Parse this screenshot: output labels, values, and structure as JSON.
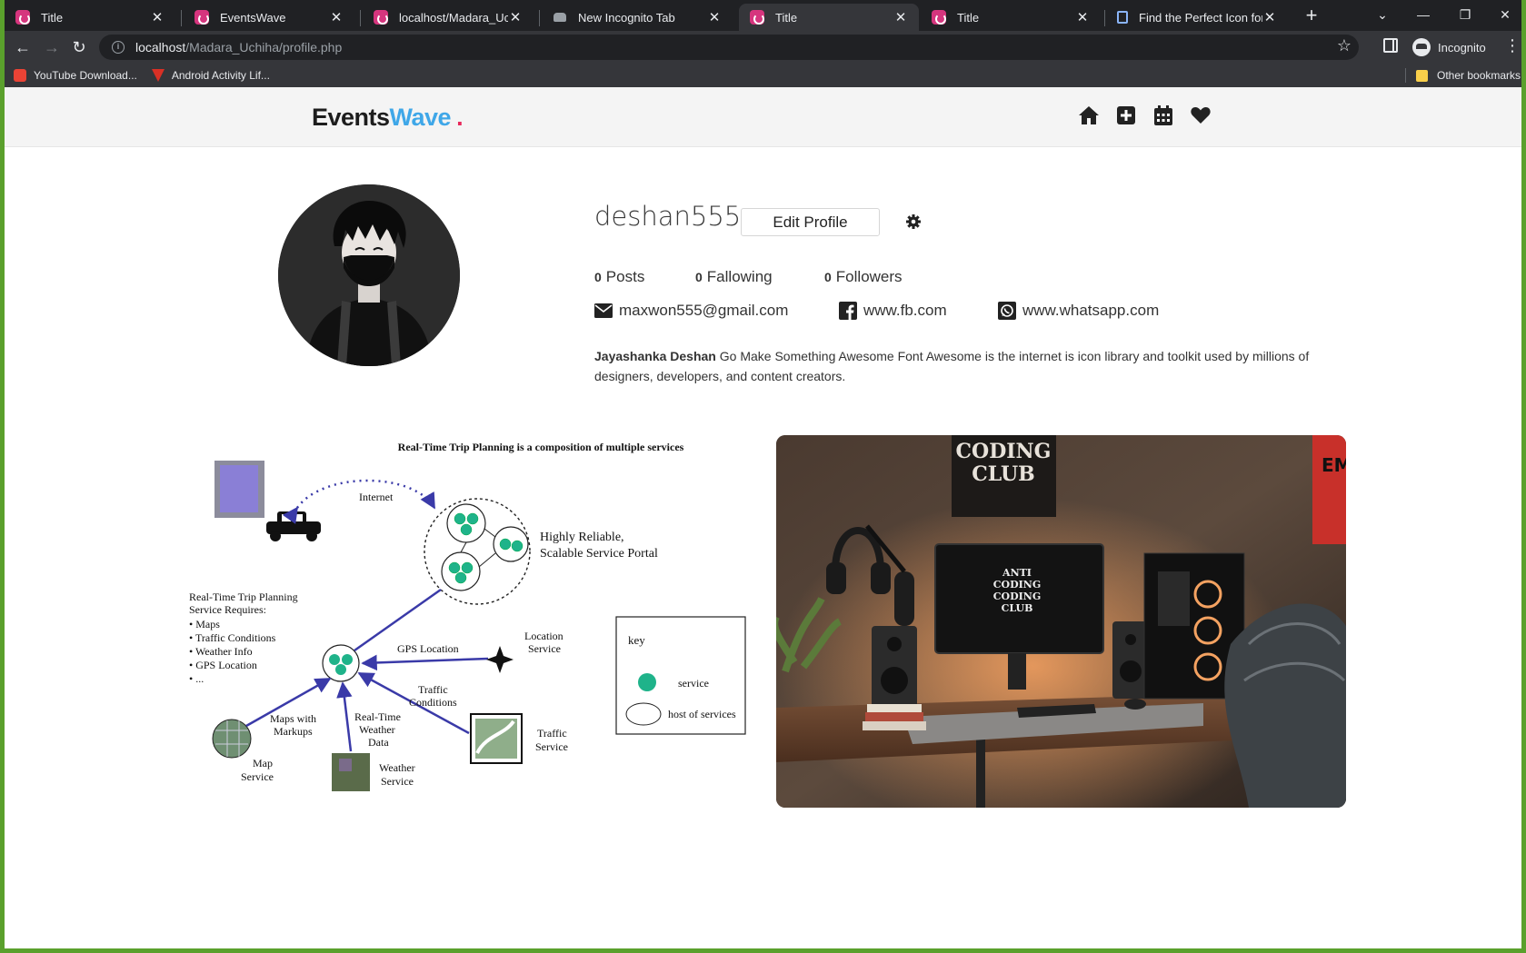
{
  "browser": {
    "tabs": [
      {
        "title": "Title",
        "favicon": "app-icon"
      },
      {
        "title": "EventsWave",
        "favicon": "app-icon"
      },
      {
        "title": "localhost/Madara_Uchiha",
        "favicon": "app-icon"
      },
      {
        "title": "New Incognito Tab",
        "favicon": "incognito-icon"
      },
      {
        "title": "Title",
        "favicon": "app-icon"
      },
      {
        "title": "Title",
        "favicon": "app-icon"
      },
      {
        "title": "Find the Perfect Icon for Y",
        "favicon": "flag-icon"
      }
    ],
    "url_host": "localhost",
    "url_path": "/Madara_Uchiha/profile.php",
    "profile_label": "Incognito",
    "bookmarks": [
      {
        "label": "YouTube Download..."
      },
      {
        "label": "Android Activity Lif..."
      }
    ],
    "other_bookmarks": "Other bookmarks"
  },
  "site": {
    "logo_part1": "Events",
    "logo_part2": "Wave",
    "logo_dot": ".",
    "nav_icons": [
      "home-icon",
      "add-square-icon",
      "calendar-icon",
      "heart-icon"
    ],
    "colors": {
      "brand_blue": "#3fa7e8",
      "brand_pink": "#e8285a"
    }
  },
  "profile": {
    "username": "deshan555",
    "edit_label": "Edit Profile",
    "stats": {
      "posts_count": "0",
      "posts_label": "Posts",
      "following_count": "0",
      "following_label": "Fallowing",
      "followers_count": "0",
      "followers_label": "Followers"
    },
    "email": "maxwon555@gmail.com",
    "facebook": "www.fb.com",
    "whatsapp": "www.whatsapp.com",
    "bio_name": "Jayashanka Deshan",
    "bio_text": " Go Make Something Awesome Font Awesome is the internet is icon library and toolkit used by millions of designers, developers, and content creators."
  },
  "posts": {
    "diagram": {
      "title": "Real-Time Trip Planning is a composition of multiple services",
      "internet": "Internet",
      "portal_1": "Highly Reliable,",
      "portal_2": "Scalable Service Portal",
      "req_1": "Real-Time Trip Planning",
      "req_2": "Service Requires:",
      "req_3": "• Maps",
      "req_4": "• Traffic Conditions",
      "req_5": "• Weather Info",
      "req_6": "• GPS Location",
      "req_7": "• ...",
      "gps": "GPS Location",
      "loc_1": "Location",
      "loc_2": "Service",
      "tc_1": "Traffic",
      "tc_2": "Conditions",
      "maps_1": "Maps with",
      "maps_2": "Markups",
      "rtw_1": "Real-Time",
      "rtw_2": "Weather",
      "rtw_3": "Data",
      "ts_1": "Traffic",
      "ts_2": "Service",
      "ms_1": "Map",
      "ms_2": "Service",
      "ws_1": "Weather",
      "ws_2": "Service",
      "key": "key",
      "key_service": "service",
      "key_host": "host of services"
    },
    "photo": {
      "poster_1": "CODING",
      "poster_2": "CLUB",
      "screen_1": "ANTI",
      "screen_2": "CODING",
      "screen_3": "CODING",
      "screen_4": "CLUB",
      "poster_right": "EM"
    }
  }
}
